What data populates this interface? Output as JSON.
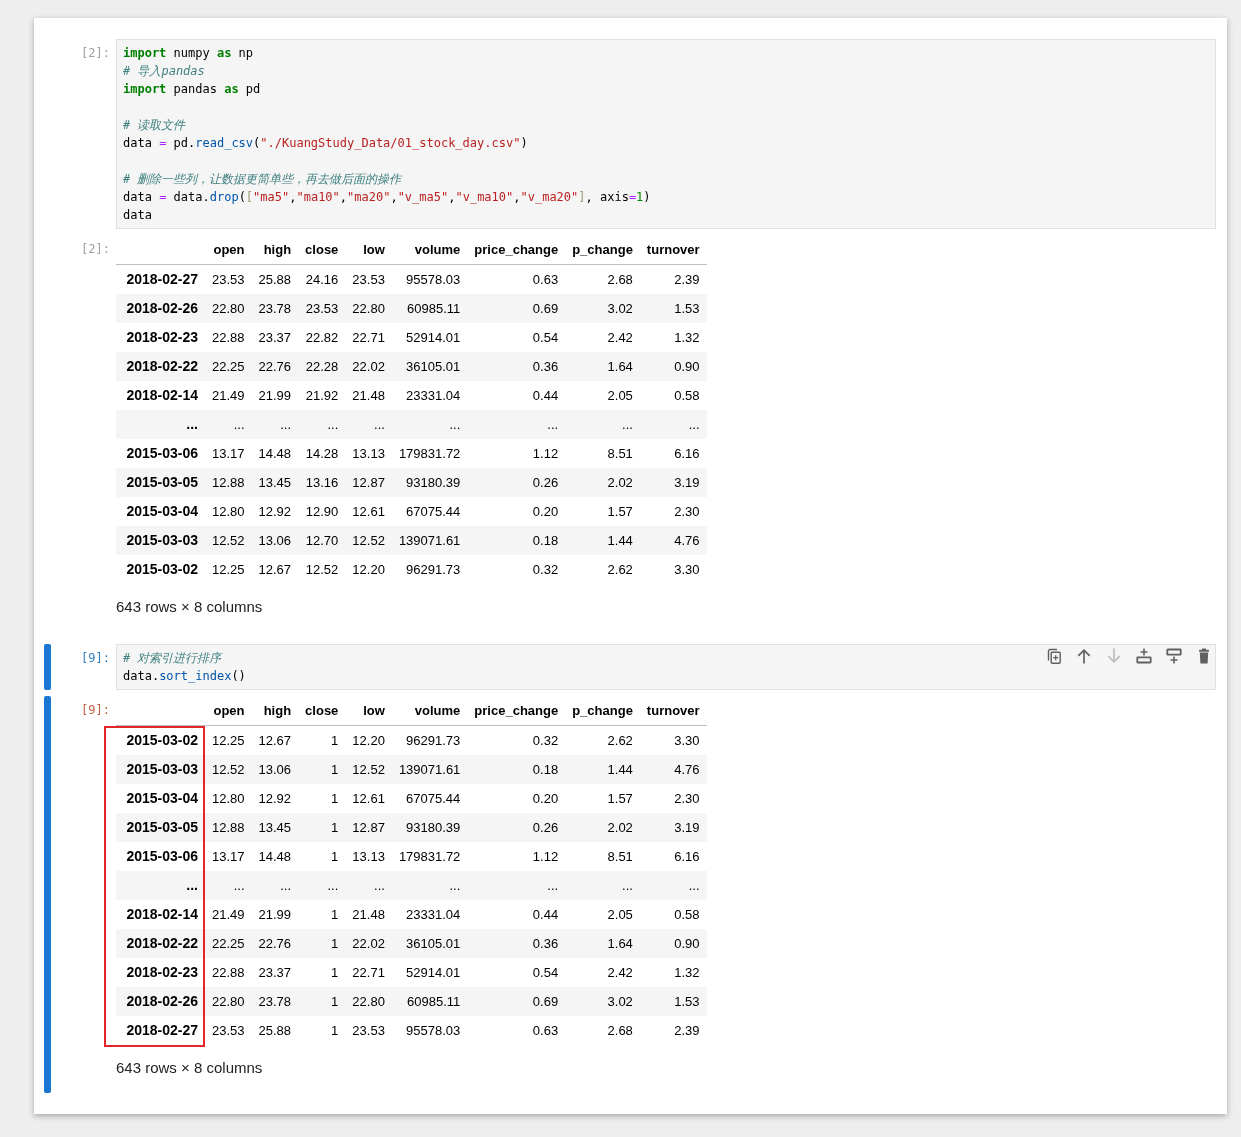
{
  "notebook": {
    "cells": [
      {
        "selected": false,
        "input": {
          "prompt": "[2]:",
          "code_blocks": [
            [
              [
                {
                  "text": "import",
                  "kind": "keyword"
                },
                {
                  "text": " numpy ",
                  "kind": "plain"
                },
                {
                  "text": "as",
                  "kind": "keyword"
                },
                {
                  "text": " np",
                  "kind": "plain"
                }
              ],
              [
                {
                  "text": "# 导入pandas",
                  "kind": "comment"
                }
              ],
              [
                {
                  "text": "import",
                  "kind": "keyword"
                },
                {
                  "text": " pandas ",
                  "kind": "plain"
                },
                {
                  "text": "as",
                  "kind": "keyword"
                },
                {
                  "text": " pd",
                  "kind": "plain"
                }
              ]
            ],
            [
              [
                {
                  "text": "# 读取文件",
                  "kind": "comment"
                }
              ],
              [
                {
                  "text": "data ",
                  "kind": "plain"
                },
                {
                  "text": "=",
                  "kind": "operator"
                },
                {
                  "text": " pd.",
                  "kind": "plain"
                },
                {
                  "text": "read_csv",
                  "kind": "function"
                },
                {
                  "text": "(",
                  "kind": "plain"
                },
                {
                  "text": "\"./KuangStudy_Data/01_stock_day.csv\"",
                  "kind": "string"
                },
                {
                  "text": ")",
                  "kind": "plain"
                }
              ]
            ],
            [
              [
                {
                  "text": "# 删除一些列，让数据更简单些，再去做后面的操作",
                  "kind": "comment"
                }
              ],
              [
                {
                  "text": "data ",
                  "kind": "plain"
                },
                {
                  "text": "=",
                  "kind": "operator"
                },
                {
                  "text": " data.",
                  "kind": "plain"
                },
                {
                  "text": "drop",
                  "kind": "function"
                },
                {
                  "text": "(",
                  "kind": "plain"
                },
                {
                  "text": "[",
                  "kind": "bracket"
                },
                {
                  "text": "\"ma5\"",
                  "kind": "string"
                },
                {
                  "text": ",",
                  "kind": "plain"
                },
                {
                  "text": "\"ma10\"",
                  "kind": "string"
                },
                {
                  "text": ",",
                  "kind": "plain"
                },
                {
                  "text": "\"ma20\"",
                  "kind": "string"
                },
                {
                  "text": ",",
                  "kind": "plain"
                },
                {
                  "text": "\"v_ma5\"",
                  "kind": "string"
                },
                {
                  "text": ",",
                  "kind": "plain"
                },
                {
                  "text": "\"v_ma10\"",
                  "kind": "string"
                },
                {
                  "text": ",",
                  "kind": "plain"
                },
                {
                  "text": "\"v_ma20\"",
                  "kind": "string"
                },
                {
                  "text": "]",
                  "kind": "bracket"
                },
                {
                  "text": ", axis",
                  "kind": "plain"
                },
                {
                  "text": "=",
                  "kind": "operator"
                },
                {
                  "text": "1",
                  "kind": "number"
                },
                {
                  "text": ")",
                  "kind": "plain"
                }
              ],
              [
                {
                  "text": "data",
                  "kind": "plain"
                }
              ]
            ]
          ]
        },
        "output": {
          "prompt": "[2]:",
          "table": {
            "columns": [
              "open",
              "high",
              "close",
              "low",
              "volume",
              "price_change",
              "p_change",
              "turnover"
            ],
            "rows": [
              {
                "index": "2018-02-27",
                "values": [
                  "23.53",
                  "25.88",
                  "24.16",
                  "23.53",
                  "95578.03",
                  "0.63",
                  "2.68",
                  "2.39"
                ]
              },
              {
                "index": "2018-02-26",
                "values": [
                  "22.80",
                  "23.78",
                  "23.53",
                  "22.80",
                  "60985.11",
                  "0.69",
                  "3.02",
                  "1.53"
                ]
              },
              {
                "index": "2018-02-23",
                "values": [
                  "22.88",
                  "23.37",
                  "22.82",
                  "22.71",
                  "52914.01",
                  "0.54",
                  "2.42",
                  "1.32"
                ]
              },
              {
                "index": "2018-02-22",
                "values": [
                  "22.25",
                  "22.76",
                  "22.28",
                  "22.02",
                  "36105.01",
                  "0.36",
                  "1.64",
                  "0.90"
                ]
              },
              {
                "index": "2018-02-14",
                "values": [
                  "21.49",
                  "21.99",
                  "21.92",
                  "21.48",
                  "23331.04",
                  "0.44",
                  "2.05",
                  "0.58"
                ]
              },
              {
                "index": "...",
                "values": [
                  "...",
                  "...",
                  "...",
                  "...",
                  "...",
                  "...",
                  "...",
                  "..."
                ]
              },
              {
                "index": "2015-03-06",
                "values": [
                  "13.17",
                  "14.48",
                  "14.28",
                  "13.13",
                  "179831.72",
                  "1.12",
                  "8.51",
                  "6.16"
                ]
              },
              {
                "index": "2015-03-05",
                "values": [
                  "12.88",
                  "13.45",
                  "13.16",
                  "12.87",
                  "93180.39",
                  "0.26",
                  "2.02",
                  "3.19"
                ]
              },
              {
                "index": "2015-03-04",
                "values": [
                  "12.80",
                  "12.92",
                  "12.90",
                  "12.61",
                  "67075.44",
                  "0.20",
                  "1.57",
                  "2.30"
                ]
              },
              {
                "index": "2015-03-03",
                "values": [
                  "12.52",
                  "13.06",
                  "12.70",
                  "12.52",
                  "139071.61",
                  "0.18",
                  "1.44",
                  "4.76"
                ]
              },
              {
                "index": "2015-03-02",
                "values": [
                  "12.25",
                  "12.67",
                  "12.52",
                  "12.20",
                  "96291.73",
                  "0.32",
                  "2.62",
                  "3.30"
                ]
              }
            ]
          },
          "summary": "643 rows × 8 columns"
        }
      },
      {
        "selected": true,
        "toolbar": [
          {
            "kind": "duplicate",
            "disabled": false
          },
          {
            "kind": "move_up",
            "disabled": false
          },
          {
            "kind": "move_down",
            "disabled": true
          },
          {
            "kind": "insert_above",
            "disabled": false
          },
          {
            "kind": "insert_below",
            "disabled": false
          },
          {
            "kind": "delete",
            "disabled": false
          }
        ],
        "input": {
          "prompt": "[9]:",
          "code_blocks": [
            [
              [
                {
                  "text": "# 对索引进行排序",
                  "kind": "comment"
                }
              ],
              [
                {
                  "text": "data.",
                  "kind": "plain"
                },
                {
                  "text": "sort_index",
                  "kind": "function"
                },
                {
                  "text": "()",
                  "kind": "plain"
                }
              ]
            ]
          ]
        },
        "output": {
          "prompt": "[9]:",
          "index_highlighted": true,
          "table": {
            "columns": [
              "open",
              "high",
              "close",
              "low",
              "volume",
              "price_change",
              "p_change",
              "turnover"
            ],
            "rows": [
              {
                "index": "2015-03-02",
                "values": [
                  "12.25",
                  "12.67",
                  "1",
                  "12.20",
                  "96291.73",
                  "0.32",
                  "2.62",
                  "3.30"
                ]
              },
              {
                "index": "2015-03-03",
                "values": [
                  "12.52",
                  "13.06",
                  "1",
                  "12.52",
                  "139071.61",
                  "0.18",
                  "1.44",
                  "4.76"
                ]
              },
              {
                "index": "2015-03-04",
                "values": [
                  "12.80",
                  "12.92",
                  "1",
                  "12.61",
                  "67075.44",
                  "0.20",
                  "1.57",
                  "2.30"
                ]
              },
              {
                "index": "2015-03-05",
                "values": [
                  "12.88",
                  "13.45",
                  "1",
                  "12.87",
                  "93180.39",
                  "0.26",
                  "2.02",
                  "3.19"
                ]
              },
              {
                "index": "2015-03-06",
                "values": [
                  "13.17",
                  "14.48",
                  "1",
                  "13.13",
                  "179831.72",
                  "1.12",
                  "8.51",
                  "6.16"
                ]
              },
              {
                "index": "...",
                "values": [
                  "...",
                  "...",
                  "...",
                  "...",
                  "...",
                  "...",
                  "...",
                  "..."
                ]
              },
              {
                "index": "2018-02-14",
                "values": [
                  "21.49",
                  "21.99",
                  "1",
                  "21.48",
                  "23331.04",
                  "0.44",
                  "2.05",
                  "0.58"
                ]
              },
              {
                "index": "2018-02-22",
                "values": [
                  "22.25",
                  "22.76",
                  "1",
                  "22.02",
                  "36105.01",
                  "0.36",
                  "1.64",
                  "0.90"
                ]
              },
              {
                "index": "2018-02-23",
                "values": [
                  "22.88",
                  "23.37",
                  "1",
                  "22.71",
                  "52914.01",
                  "0.54",
                  "2.42",
                  "1.32"
                ]
              },
              {
                "index": "2018-02-26",
                "values": [
                  "22.80",
                  "23.78",
                  "1",
                  "22.80",
                  "60985.11",
                  "0.69",
                  "3.02",
                  "1.53"
                ]
              },
              {
                "index": "2018-02-27",
                "values": [
                  "23.53",
                  "25.88",
                  "1",
                  "23.53",
                  "95578.03",
                  "0.63",
                  "2.68",
                  "2.39"
                ]
              }
            ]
          },
          "summary": "643 rows × 8 columns"
        }
      }
    ]
  }
}
